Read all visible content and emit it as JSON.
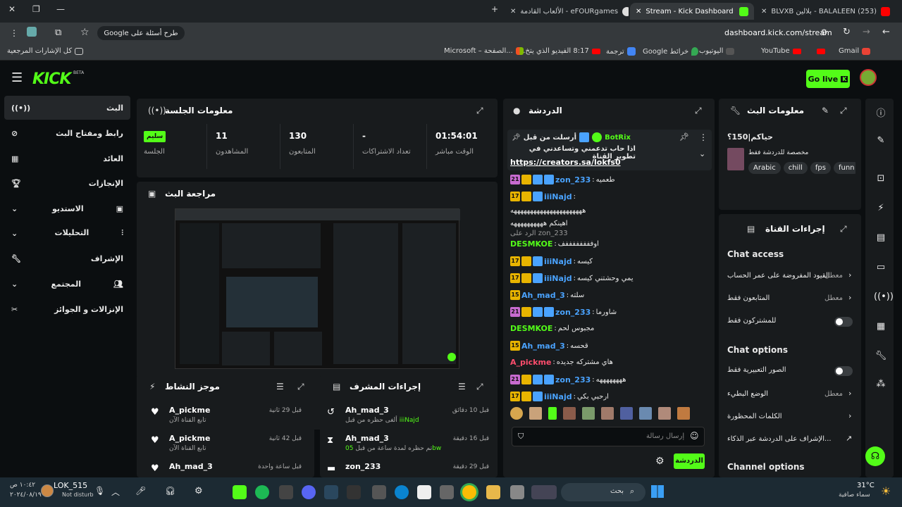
{
  "browser": {
    "tabs": [
      {
        "label": "(253) BALALEEN - بلالين BLVXB"
      },
      {
        "label": "Stream - Kick Dashboard"
      },
      {
        "label": "الألعاب القادمة - eFOURgames"
      }
    ],
    "url": "dashboard.kick.com/stream",
    "search_placeholder": "طرح أسئلة على Google",
    "bookmarks": [
      "Gmail",
      "YouTube",
      "اليوتيوب",
      "Google خرائط",
      "ترجمة",
      "8:17 الفيديو الذي يتخ...",
      "Microsoft – الصفحة...",
      "كل الإشارات المرجعية"
    ]
  },
  "header": {
    "logo": "KICK",
    "logo_beta": "BETA",
    "go_live": "Go live"
  },
  "sidebar": {
    "items": [
      {
        "label": "البث",
        "icon": "broadcast-icon"
      },
      {
        "label": "رابط ومفتاح البث",
        "icon": "link-icon"
      },
      {
        "label": "العائد",
        "icon": "chart-icon"
      },
      {
        "label": "الإنجازات",
        "icon": "trophy-icon"
      },
      {
        "label": "الاستديو",
        "icon": "studio-icon"
      },
      {
        "label": "التحليلات",
        "icon": "analytics-icon"
      },
      {
        "label": "الإشراف",
        "icon": "wrench-icon"
      },
      {
        "label": "المجتمع",
        "icon": "community-icon"
      },
      {
        "label": "الإنزالات و الجوائز",
        "icon": "drops-icon"
      }
    ]
  },
  "session": {
    "title": "معلومات الجلسة",
    "stats": [
      {
        "label": "الوقت مباشر",
        "value": "01:54:01"
      },
      {
        "label": "تعداد الاشتراكات",
        "value": "-"
      },
      {
        "label": "المتابعون",
        "value": "130"
      },
      {
        "label": "المشاهدون",
        "value": "11"
      },
      {
        "label": "الجلسة",
        "value": "سليم"
      }
    ]
  },
  "preview": {
    "title": "مراجعة البث"
  },
  "activity": {
    "title": "موجز النشاط",
    "items": [
      {
        "name": "A_pickme",
        "sub": "تابع القناة الآن",
        "time": "قبل 29 ثانية"
      },
      {
        "name": "A_pickme",
        "sub": "تابع القناة الآن",
        "time": "قبل 42 ثانية"
      },
      {
        "name": "Ah_mad_3",
        "sub": "",
        "time": "قبل ساعة واحدة"
      }
    ]
  },
  "modactions": {
    "title": "إجراءات المشرف",
    "items": [
      {
        "name": "Ah_mad_3",
        "sub": "ألغى حظره من قبل",
        "target": "iiiNajd",
        "time": "قبل 10 دقائق"
      },
      {
        "name": "Ah_mad_3",
        "sub": "تم حظره لمدة ساعة من قبل",
        "target": "05bw",
        "time": "قبل 16 دقيقة"
      },
      {
        "name": "zon_233",
        "sub": "",
        "target": "",
        "time": "قبل 29 دقيقة"
      }
    ]
  },
  "chat": {
    "title": "الدردشة",
    "pinned_by": "أرسلت من قبل",
    "pinned_user": "BotRix",
    "pinned_text": "اذا حاب تدعمني وتساعدني في تطوير القناة",
    "pinned_link": "https://creators.sa/lokfs0",
    "messages": [
      {
        "user": "zon_233",
        "text": "طعميه",
        "color": "#4aa3ff"
      },
      {
        "user": "iiiNajd",
        "text": "",
        "color": "#4aa3ff"
      },
      {
        "user": "",
        "text": "ههههههههههههههههههههههه",
        "color": "#e8e8e8"
      },
      {
        "user": "",
        "text": "اهينكم ههههههههههه",
        "color": "#e8e8e8"
      },
      {
        "user": "",
        "text": "zon_233 الرد على",
        "color": "#999"
      },
      {
        "user": "DESMKOE",
        "text": "اوففففففففف",
        "color": "#53fc18"
      },
      {
        "user": "iiiNajd",
        "text": "كيسه",
        "color": "#4aa3ff"
      },
      {
        "user": "iiiNajd",
        "text": "يمي وحشتني كيسه",
        "color": "#4aa3ff"
      },
      {
        "user": "Ah_mad_3",
        "text": "سلته",
        "color": "#4aa3ff"
      },
      {
        "user": "zon_233",
        "text": "شاورما",
        "color": "#4aa3ff"
      },
      {
        "user": "DESMKOE",
        "text": "مجبوس لحم",
        "color": "#53fc18"
      },
      {
        "user": "Ah_mad_3",
        "text": "قحسه",
        "color": "#4aa3ff"
      },
      {
        "user": "A_pickme",
        "text": "هاي مشتركه جديده",
        "color": "#ff4d6d"
      },
      {
        "user": "zon_233",
        "text": "ههههههههه",
        "color": "#4aa3ff"
      },
      {
        "user": "iiiNajd",
        "text": "ارحبي بكي",
        "color": "#4aa3ff"
      }
    ],
    "input_placeholder": "إرسال رسالة",
    "send_label": "الدردشة"
  },
  "stream_info": {
    "title": "معلومات البث",
    "stream_title": "حياكم|150؟",
    "category": "مخصصة للدردشة فقط",
    "tags": [
      "Arabic",
      "chill",
      "fps",
      "funn"
    ]
  },
  "channel_actions": {
    "title": "إجراءات القناة",
    "chat_access_heading": "Chat access",
    "chat_access": [
      {
        "label": "القيود المفروضة على عمر الحساب",
        "state": "معطل"
      },
      {
        "label": "المتابعون فقط",
        "state": "معطل"
      },
      {
        "label": "للمشتركون فقط",
        "state": ""
      }
    ],
    "chat_options_heading": "Chat options",
    "chat_options": [
      {
        "label": "الصور التعبيرية فقط",
        "state": ""
      },
      {
        "label": "الوضع البطيء",
        "state": "معطل"
      },
      {
        "label": "الكلمات المحظورة",
        "state": ""
      },
      {
        "label": "الإشراف على الدردشة عبر الذكاء...",
        "state": ""
      }
    ],
    "channel_options_heading": "Channel options"
  },
  "taskbar": {
    "user": "LOK_515",
    "status": "Not disturb",
    "search": "بحث",
    "weather_temp": "31°C",
    "weather_desc": "سماء صافية",
    "time": "١٠:٤٢ ص",
    "date": "٢٠٢٤/٠٨/١٩"
  },
  "colors": {
    "accent": "#53fc18",
    "panel": "#181b1d",
    "bg": "#0b0e10"
  }
}
